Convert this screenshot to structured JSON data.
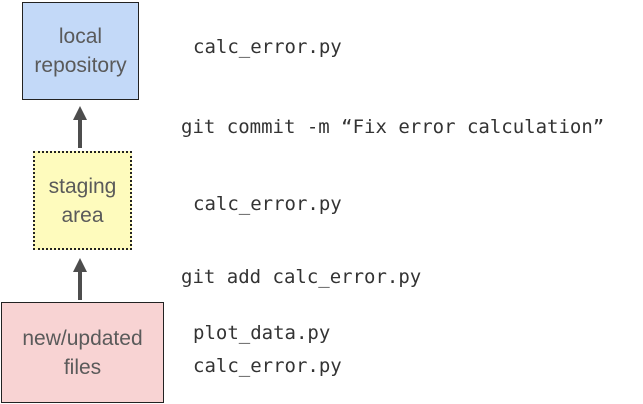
{
  "boxes": {
    "local_repository": {
      "line1": "local",
      "line2": "repository",
      "color": "#c3d9f8"
    },
    "staging_area": {
      "line1": "staging",
      "line2": "area",
      "color": "#fefbbd"
    },
    "new_updated_files": {
      "line1": "new/updated",
      "line2": "files",
      "color": "#f8d3d3"
    }
  },
  "commands": {
    "commit": "git commit -m “Fix error calculation”",
    "add": "git add calc_error.py"
  },
  "files": {
    "repository": "calc_error.py",
    "staging": "calc_error.py",
    "working": [
      "plot_data.py",
      "calc_error.py"
    ]
  },
  "icons": {
    "arrow_to_repository": "arrow-up-icon",
    "arrow_to_staging": "arrow-up-icon"
  }
}
